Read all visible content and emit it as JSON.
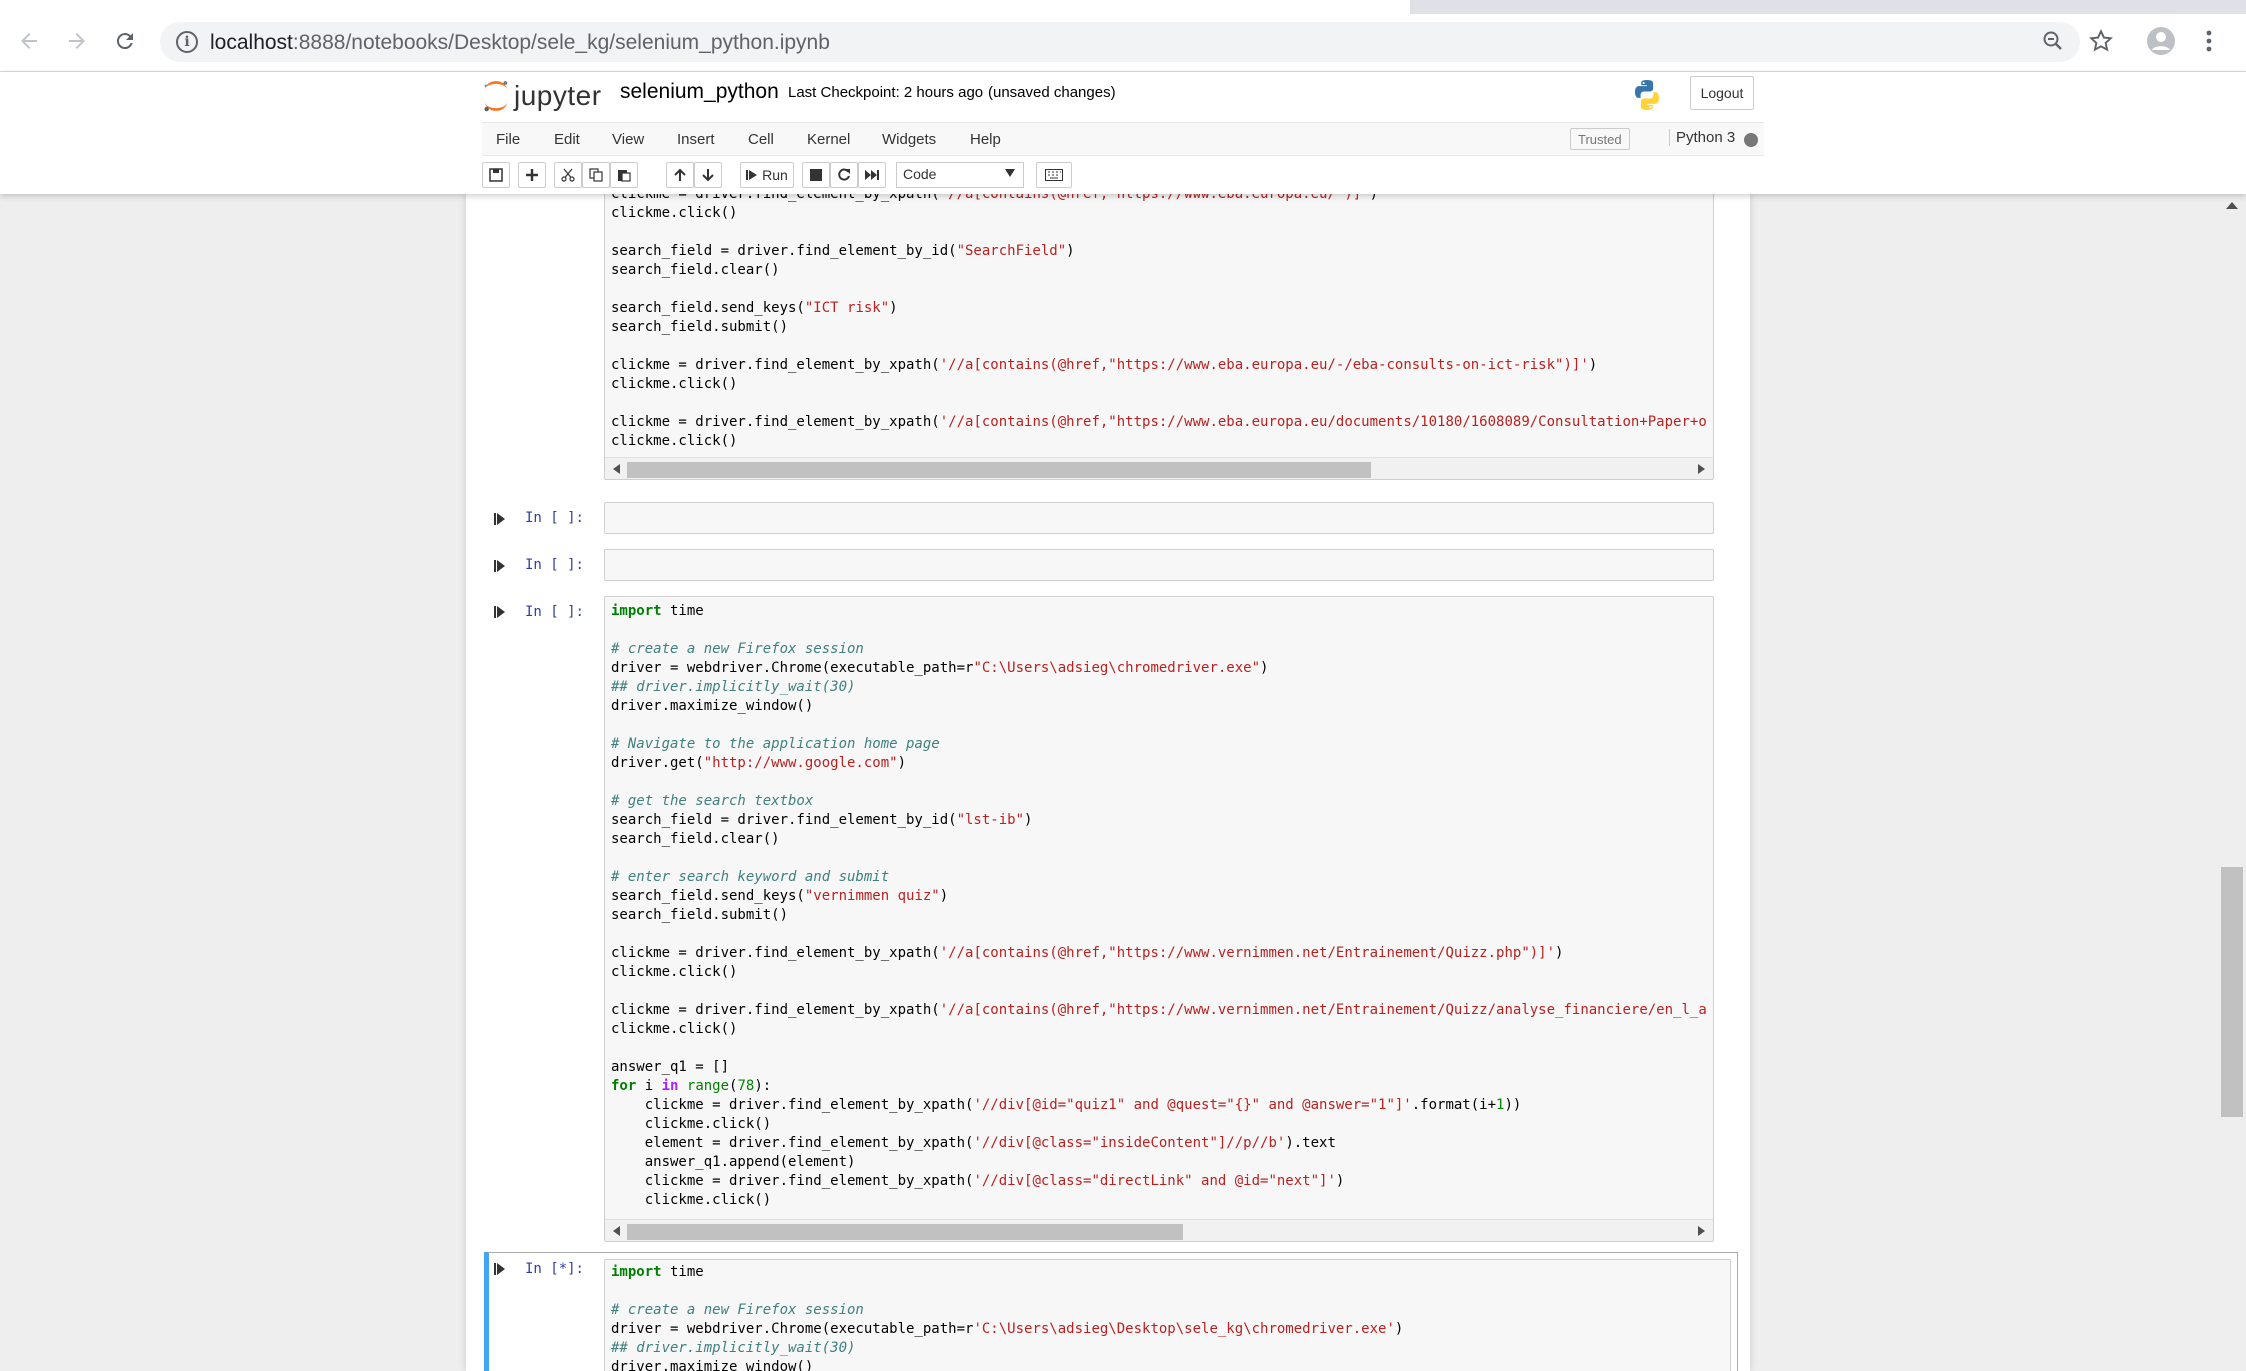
{
  "browser": {
    "url_host": "localhost",
    "url_path": ":8888/notebooks/Desktop/sele_kg/selenium_python.ipynb"
  },
  "header": {
    "logo_text": "jupyter",
    "notebook_name": "selenium_python",
    "checkpoint": "Last Checkpoint: 2 hours ago",
    "unsaved": "(unsaved changes)",
    "logout_label": "Logout"
  },
  "menubar": {
    "items": [
      "File",
      "Edit",
      "View",
      "Insert",
      "Cell",
      "Kernel",
      "Widgets",
      "Help"
    ],
    "trusted": "Trusted",
    "kernel_name": "Python 3"
  },
  "toolbar": {
    "run_label": "Run",
    "cell_type": "Code"
  },
  "cells": {
    "cell1_lines": [
      "clickme = driver.find_element_by_xpath('//a[contains(@href,\"https://www.eba.europa.eu/\")]')",
      "clickme.click()",
      "",
      "search_field = driver.find_element_by_id(\"SearchField\")",
      "search_field.clear()",
      "",
      "search_field.send_keys(\"ICT risk\")",
      "search_field.submit()",
      "",
      "clickme = driver.find_element_by_xpath('//a[contains(@href,\"https://www.eba.europa.eu/-/eba-consults-on-ict-risk\")]')",
      "clickme.click()",
      "",
      "clickme = driver.find_element_by_xpath('//a[contains(@href,\"https://www.eba.europa.eu/documents/10180/1608089/Consultation+Paper+o",
      "clickme.click()"
    ],
    "prompt_empty": "In [ ]:",
    "prompt_running": "In [*]:",
    "cell4_lines": [
      "import time",
      "",
      "# create a new Firefox session",
      "driver = webdriver.Chrome(executable_path=r\"C:\\Users\\adsieg\\chromedriver.exe\")",
      "## driver.implicitly_wait(30)",
      "driver.maximize_window()",
      "",
      "# Navigate to the application home page",
      "driver.get(\"http://www.google.com\")",
      "",
      "# get the search textbox",
      "search_field = driver.find_element_by_id(\"lst-ib\")",
      "search_field.clear()",
      "",
      "# enter search keyword and submit",
      "search_field.send_keys(\"vernimmen quiz\")",
      "search_field.submit()",
      "",
      "clickme = driver.find_element_by_xpath('//a[contains(@href,\"https://www.vernimmen.net/Entrainement/Quizz.php\")]')",
      "clickme.click()",
      "",
      "clickme = driver.find_element_by_xpath('//a[contains(@href,\"https://www.vernimmen.net/Entrainement/Quizz/analyse_financiere/en_l_a",
      "clickme.click()",
      "",
      "answer_q1 = []",
      "for i in range(78):",
      "    clickme = driver.find_element_by_xpath('//div[@id=\"quiz1\" and @quest=\"{}\" and @answer=\"1\"]'.format(i+1))",
      "    clickme.click()",
      "    element = driver.find_element_by_xpath('//div[@class=\"insideContent\"]//p//b').text",
      "    answer_q1.append(element)",
      "    clickme = driver.find_element_by_xpath('//div[@class=\"directLink\" and @id=\"next\"]')",
      "    clickme.click()"
    ],
    "cell5_lines": [
      "import time",
      "",
      "# create a new Firefox session",
      "driver = webdriver.Chrome(executable_path=r'C:\\Users\\adsieg\\Desktop\\sele_kg\\chromedriver.exe')",
      "## driver.implicitly_wait(30)",
      "driver.maximize_window()"
    ]
  }
}
